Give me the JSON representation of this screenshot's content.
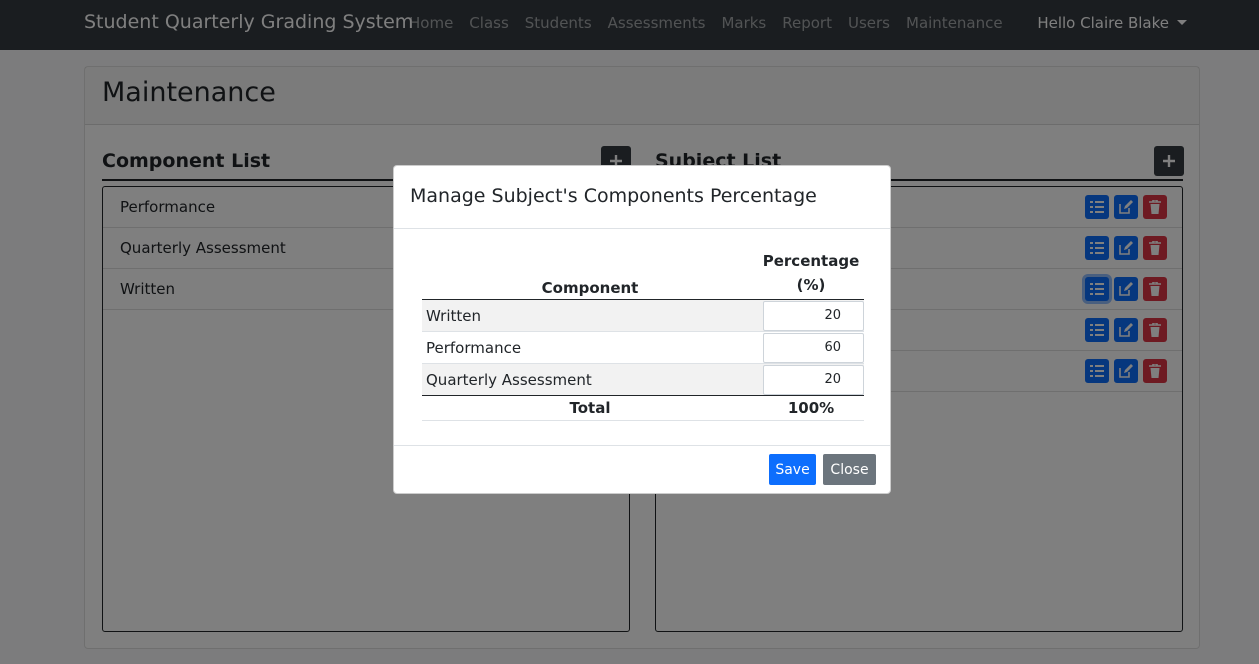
{
  "navbar": {
    "brand": "Student Quarterly Grading System",
    "links": [
      "Home",
      "Class",
      "Students",
      "Assessments",
      "Marks",
      "Report",
      "Users",
      "Maintenance"
    ],
    "user_greeting": "Hello Claire Blake"
  },
  "page": {
    "title": "Maintenance"
  },
  "component_list": {
    "title": "Component List",
    "items": [
      "Performance",
      "Quarterly Assessment",
      "Written"
    ]
  },
  "subject_list": {
    "title": "Subject List",
    "row_count": 5
  },
  "modal": {
    "title": "Manage Subject's Components Percentage",
    "headers": {
      "component": "Component",
      "percentage": "Percentage (%)"
    },
    "rows": [
      {
        "component": "Written",
        "percentage": "20"
      },
      {
        "component": "Performance",
        "percentage": "60"
      },
      {
        "component": "Quarterly Assessment",
        "percentage": "20"
      }
    ],
    "total_label": "Total",
    "total_value": "100%",
    "save_label": "Save",
    "close_label": "Close"
  },
  "colors": {
    "primary": "#0d6efd",
    "danger": "#dc3545",
    "dark": "#343a40",
    "secondary": "#6c757d"
  }
}
